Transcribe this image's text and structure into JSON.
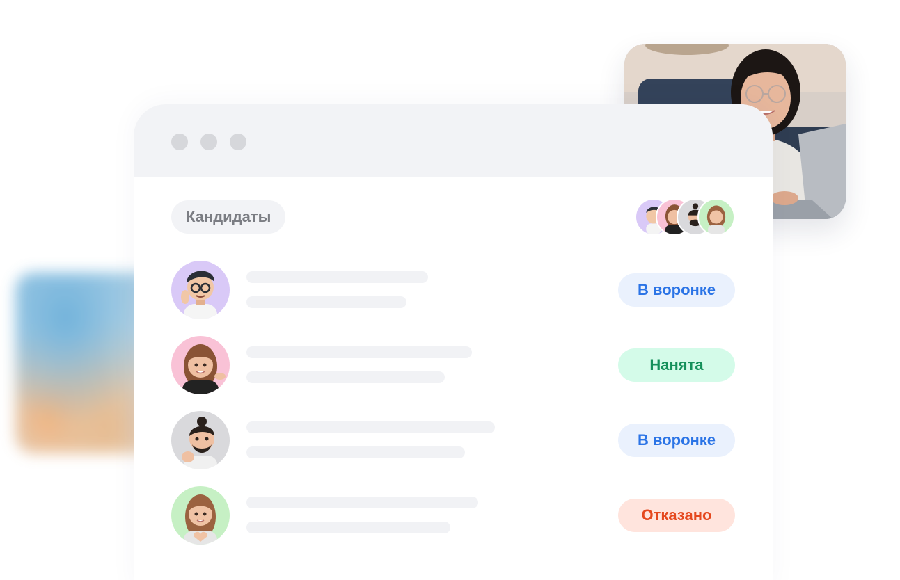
{
  "panel": {
    "title": "Кандидаты"
  },
  "candidates": [
    {
      "status": "В воронке",
      "status_color": "#2b74e6",
      "avatar_bg": "#d9c9f7"
    },
    {
      "status": "Нанята",
      "status_color": "#14905a",
      "avatar_bg": "#f9c2d6"
    },
    {
      "status": "В воронке",
      "status_color": "#2b74e6",
      "avatar_bg": "#d9d9dc"
    },
    {
      "status": "Отказано",
      "status_color": "#e5481e",
      "avatar_bg": "#c6f0c4"
    }
  ],
  "colors": {
    "titlebar": "#f2f3f6",
    "window_dots": "#d6d7db",
    "skeleton": "#f1f2f5"
  }
}
